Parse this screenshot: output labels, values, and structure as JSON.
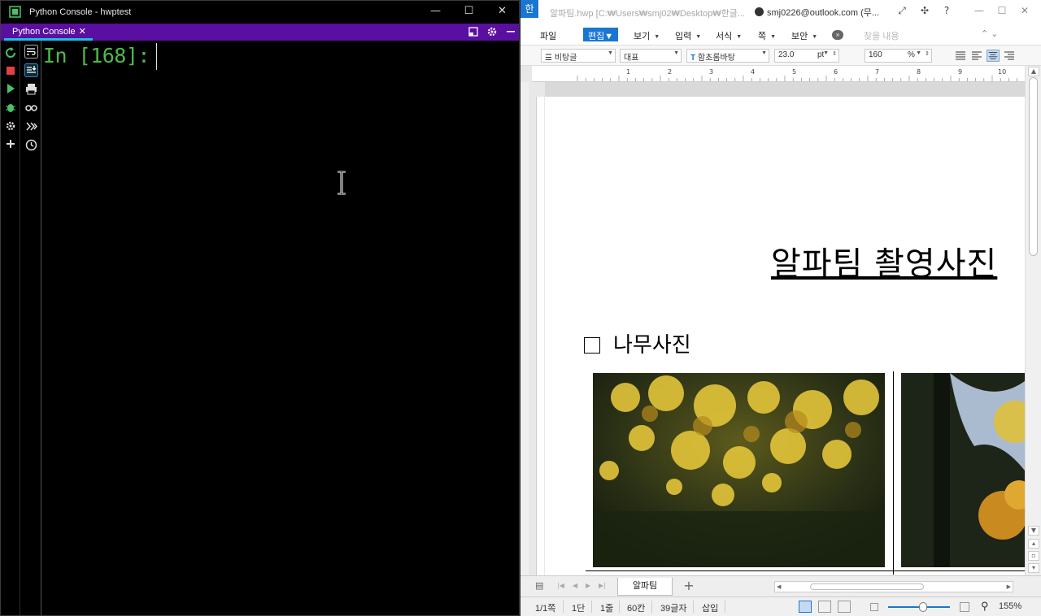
{
  "python_console": {
    "window_title": "Python Console - hwptest",
    "tab_label": "Python Console",
    "tab_close": "✕",
    "prompt": "In [168]:",
    "window_controls": {
      "minimize": "—",
      "maximize": "☐",
      "close": "✕"
    },
    "tabbar_icons": [
      "restore-icon",
      "gear-icon",
      "minimize-icon"
    ],
    "toolbar_icons": [
      "rerun-icon",
      "stop-icon",
      "run-icon",
      "debug-icon",
      "settings-icon",
      "add-icon"
    ],
    "toolbar_icons_2": [
      "soft-wrap-icon",
      "scroll-to-end-icon",
      "print-icon",
      "variables-icon",
      "execute-icon",
      "history-icon"
    ],
    "colors": {
      "accent": "#5a0fa0",
      "tab_underline": "#19c0e6",
      "prompt": "#4fb84f"
    }
  },
  "hwp": {
    "doc_title": "알파팀.hwp [C:₩Users₩smj02₩Desktop₩한글...",
    "user": "smj0226@outlook.com (무...",
    "title_icons": [
      "fullscreen-icon",
      "layout-icon",
      "help-icon"
    ],
    "window_controls": {
      "minimize": "—",
      "maximize": "☐",
      "close": "✕"
    },
    "logo": "한",
    "menu": {
      "file": "파일",
      "edit": "편집",
      "view": "보기",
      "insert": "입력",
      "format": "서식",
      "page": "쪽",
      "security": "보안",
      "more": "»",
      "search_placeholder": "찾을 내용",
      "right_controls": "⌃  ⌄"
    },
    "toolbar": {
      "style": "비탕글",
      "lang": "대표",
      "font": "함초롬바탕",
      "font_size": "23.0",
      "size_unit": "pt",
      "zoom": "160",
      "zoom_unit": "%"
    },
    "ruler_numbers": [
      "1",
      "2",
      "3",
      "4",
      "5",
      "6",
      "7",
      "8",
      "9",
      "10"
    ],
    "document": {
      "title": "알파팀 촬영사진",
      "section_heading": "나무사진"
    },
    "sheet_tab": "알파팀",
    "sheet_add": "+",
    "status": {
      "page": "1/1쪽",
      "column": "1단",
      "line": "1줄",
      "col": "60칸",
      "chars": "39글자",
      "mode": "삽입",
      "zoom": "155%"
    },
    "colors": {
      "brand": "#1a76d2"
    }
  }
}
